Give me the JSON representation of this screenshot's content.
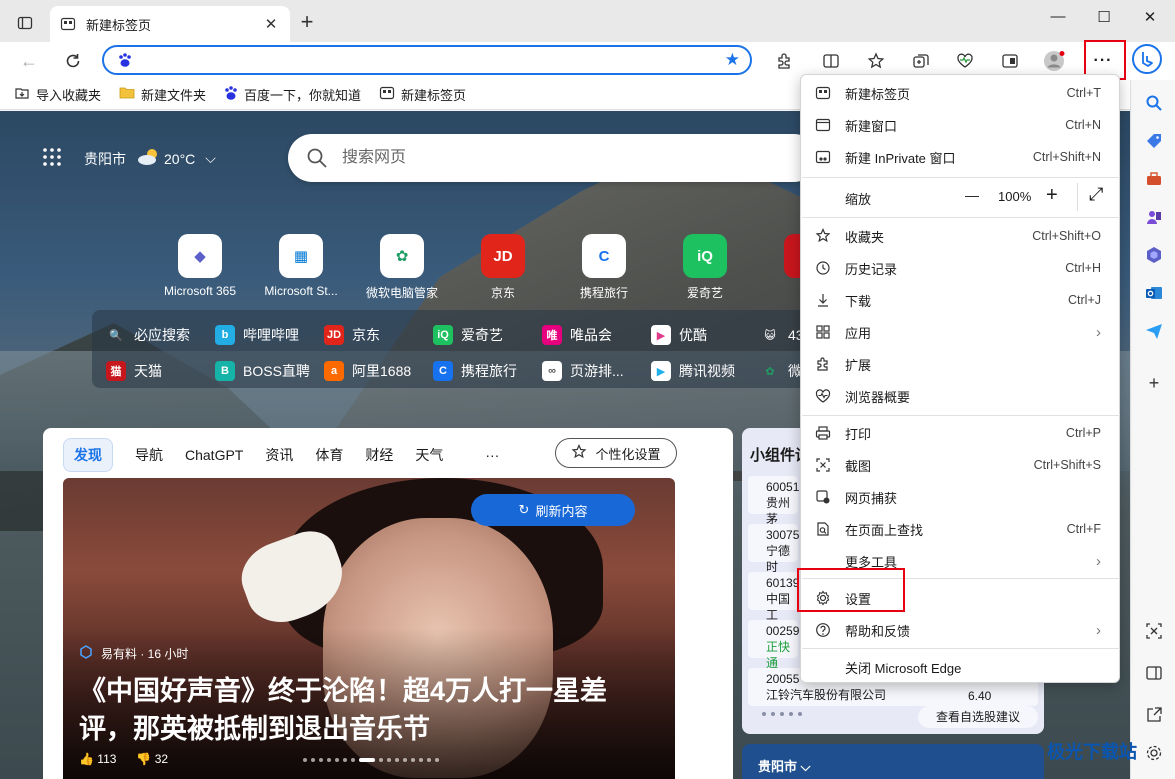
{
  "tab": {
    "title": "新建标签页",
    "close": "✕",
    "new": "+"
  },
  "window": {
    "minimize": "—",
    "maximize": "☐",
    "close": "✕"
  },
  "address": {
    "value": "",
    "placeholder": ""
  },
  "favorites": [
    {
      "label": "导入收藏夹",
      "icon": "import-icon"
    },
    {
      "label": "新建文件夹",
      "icon": "folder-icon"
    },
    {
      "label": "百度一下，你就知道",
      "icon": "baidu-icon"
    },
    {
      "label": "新建标签页",
      "icon": "newtab-icon"
    }
  ],
  "weather": {
    "city": "贵阳市",
    "temp": "20°C"
  },
  "search": {
    "placeholder": "搜索网页"
  },
  "quicklinks": [
    {
      "label": "Microsoft 365",
      "glyph": "◆",
      "color": "#5b5fc7"
    },
    {
      "label": "Microsoft St...",
      "glyph": "▦",
      "color": "#0078d4"
    },
    {
      "label": "微软电脑管家",
      "glyph": "✿",
      "color": "#1e9e64"
    },
    {
      "label": "京东",
      "glyph": "JD",
      "color": "#e1251b"
    },
    {
      "label": "携程旅行",
      "glyph": "C",
      "color": "#1672ee"
    },
    {
      "label": "爱奇艺",
      "glyph": "iQ",
      "color": "#1ec15f"
    },
    {
      "label": "天",
      "glyph": "▶",
      "color": "#c8161d"
    }
  ],
  "links_row1": [
    {
      "label": "必应搜索",
      "glyph": "🔍",
      "color": "#2b7de9"
    },
    {
      "label": "哔哩哔哩",
      "glyph": "b",
      "color": "#23ade5"
    },
    {
      "label": "京东",
      "glyph": "JD",
      "color": "#e1251b"
    },
    {
      "label": "爱奇艺",
      "glyph": "iQ",
      "color": "#1ec15f"
    },
    {
      "label": "唯品会",
      "glyph": "唯",
      "color": "#e6007e"
    },
    {
      "label": "优酷",
      "glyph": "▶",
      "color": "#e03a8a"
    },
    {
      "label": "43",
      "glyph": "😺",
      "color": "#f0a500"
    }
  ],
  "links_row2": [
    {
      "label": "天猫",
      "glyph": "猫",
      "color": "#c8161d"
    },
    {
      "label": "BOSS直聘",
      "glyph": "B",
      "color": "#15b3a8"
    },
    {
      "label": "阿里1688",
      "glyph": "a",
      "color": "#ff6a00"
    },
    {
      "label": "携程旅行",
      "glyph": "C",
      "color": "#1672ee"
    },
    {
      "label": "页游排...",
      "glyph": "∞",
      "color": "#666666"
    },
    {
      "label": "腾讯视频",
      "glyph": "▶",
      "color": "#20b0e8"
    },
    {
      "label": "微",
      "glyph": "✿",
      "color": "#1e9e64"
    }
  ],
  "feedtabs": [
    "发现",
    "导航",
    "ChatGPT",
    "资讯",
    "体育",
    "财经",
    "天气",
    "···"
  ],
  "personalize": "个性化设置",
  "hero": {
    "refresh": "刷新内容",
    "source": "易有料 · 16 小时",
    "headline": "《中国好声音》终于沦陷！超4万人打一星差评，那英被抵制到退出音乐节",
    "likes": "113",
    "dislikes": "32"
  },
  "widget": {
    "title": "小组件设",
    "stocks": [
      {
        "code": "60051",
        "name": "贵州茅"
      },
      {
        "code": "30075",
        "name": "宁德时"
      },
      {
        "code": "60139",
        "name": "中国工"
      },
      {
        "code": "00259",
        "name": "正快通"
      },
      {
        "code": "20055",
        "name": "江铃汽车股份有限公司",
        "price": "6.40"
      }
    ],
    "suggest": "查看自选股建议"
  },
  "city_card": "贵阳市",
  "menu": {
    "items_top": [
      {
        "label": "新建标签页",
        "shortcut": "Ctrl+T",
        "icon": "newtab-icon"
      },
      {
        "label": "新建窗口",
        "shortcut": "Ctrl+N",
        "icon": "window-icon"
      },
      {
        "label": "新建 InPrivate 窗口",
        "shortcut": "Ctrl+Shift+N",
        "icon": "inprivate-icon"
      }
    ],
    "zoom": {
      "label": "缩放",
      "minus": "—",
      "value": "100%",
      "plus": "+",
      "fullscreen": "⤢"
    },
    "items_mid": [
      {
        "label": "收藏夹",
        "shortcut": "Ctrl+Shift+O",
        "icon": "favorites-icon"
      },
      {
        "label": "历史记录",
        "shortcut": "Ctrl+H",
        "icon": "history-icon"
      },
      {
        "label": "下载",
        "shortcut": "Ctrl+J",
        "icon": "download-icon"
      },
      {
        "label": "应用",
        "shortcut": "›",
        "icon": "apps-icon"
      },
      {
        "label": "扩展",
        "shortcut": "",
        "icon": "extensions-icon"
      },
      {
        "label": "浏览器概要",
        "shortcut": "",
        "icon": "heartbeat-icon"
      }
    ],
    "items_tools": [
      {
        "label": "打印",
        "shortcut": "Ctrl+P",
        "icon": "print-icon"
      },
      {
        "label": "截图",
        "shortcut": "Ctrl+Shift+S",
        "icon": "screenshot-icon"
      },
      {
        "label": "网页捕获",
        "shortcut": "",
        "icon": "capture-icon"
      },
      {
        "label": "在页面上查找",
        "shortcut": "Ctrl+F",
        "icon": "find-icon"
      },
      {
        "label": "更多工具",
        "shortcut": "›",
        "icon": ""
      }
    ],
    "items_bottom": [
      {
        "label": "设置",
        "shortcut": "",
        "icon": "settings-icon"
      },
      {
        "label": "帮助和反馈",
        "shortcut": "›",
        "icon": "help-icon"
      },
      {
        "label": "关闭 Microsoft Edge",
        "shortcut": "",
        "icon": ""
      }
    ]
  },
  "watermark": "极光下载站",
  "feedback": "反馈",
  "accent": "#1a73e8",
  "highlight": "#e60012"
}
